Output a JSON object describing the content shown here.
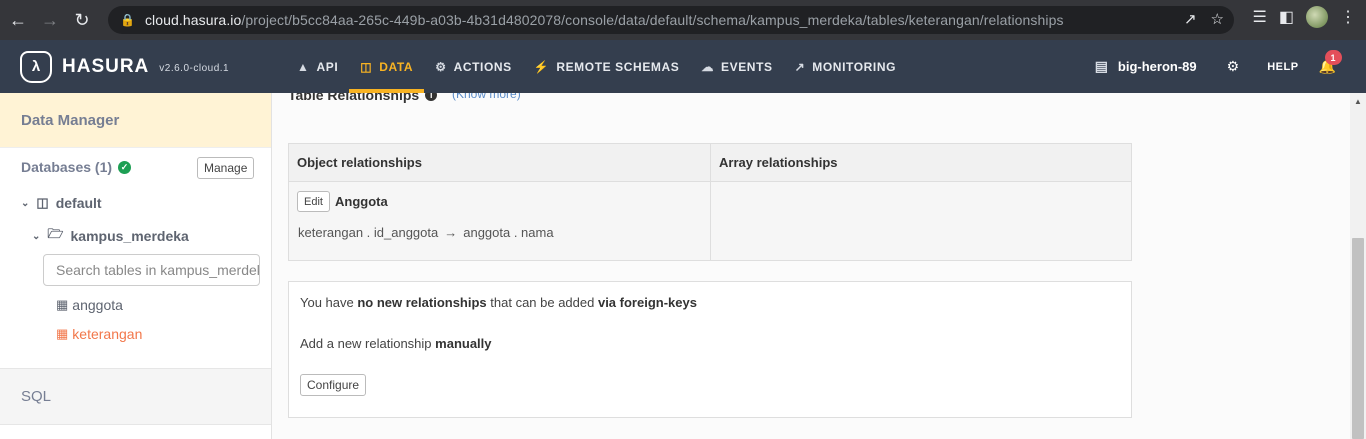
{
  "browser": {
    "url_host": "cloud.hasura.io",
    "url_path": "/project/b5cc84aa-265c-449b-a03b-4b31d4802078/console/data/default/schema/kampus_merdeka/tables/keterangan/relationships"
  },
  "header": {
    "logo_text": "HASURA",
    "version": "v2.6.0-cloud.1",
    "nav": [
      {
        "label": "API",
        "icon": "flask-icon"
      },
      {
        "label": "DATA",
        "icon": "database-icon",
        "active": true
      },
      {
        "label": "ACTIONS",
        "icon": "cogs-icon"
      },
      {
        "label": "REMOTE SCHEMAS",
        "icon": "plug-icon"
      },
      {
        "label": "EVENTS",
        "icon": "cloud-icon"
      },
      {
        "label": "MONITORING",
        "icon": "chart-line-icon"
      }
    ],
    "project_name": "big-heron-89",
    "help_label": "HELP",
    "notification_count": "1"
  },
  "sidebar": {
    "title": "Data Manager",
    "databases_label": "Databases (1)",
    "manage_label": "Manage",
    "db_name": "default",
    "schema_name": "kampus_merdeka",
    "search_placeholder": "Search tables in kampus_merdeka",
    "tables": [
      "anggota",
      "keterangan"
    ],
    "active_table": "keterangan",
    "sql_label": "SQL"
  },
  "main": {
    "section_title": "Table Relationships",
    "know_more": "(Know more)",
    "object_rel_header": "Object relationships",
    "array_rel_header": "Array relationships",
    "edit_label": "Edit",
    "rel_name": "Anggota",
    "mapping_from": "keterangan . id_anggota",
    "mapping_arrow": "→",
    "mapping_to": "anggota . nama",
    "fk_prefix": "You have ",
    "fk_bold1": "no new relationships",
    "fk_mid": " that can be added ",
    "fk_bold2": "via foreign-keys",
    "manual_prefix": "Add a new relationship ",
    "manual_bold": "manually",
    "configure_label": "Configure"
  }
}
